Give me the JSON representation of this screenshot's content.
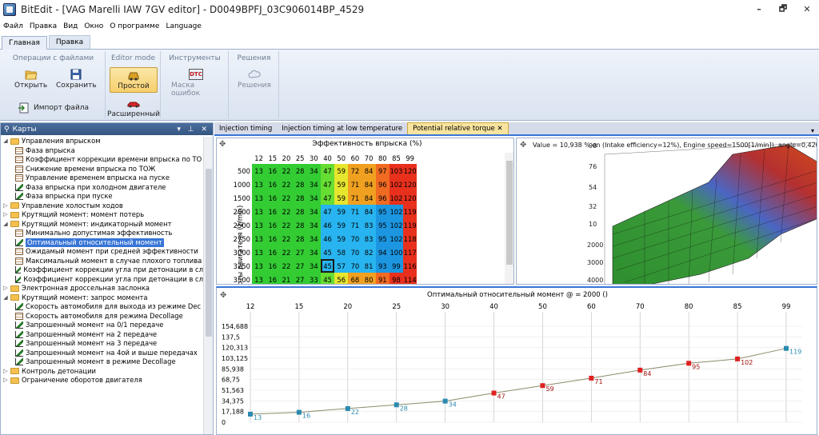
{
  "title": "BitEdit - [VAG Marelli IAW 7GV editor] - D0049BPFJ_03C906014BP_4529",
  "window_buttons": [
    "–",
    "🗗",
    "✕"
  ],
  "menu": [
    "Файл",
    "Правка",
    "Вид",
    "Окно",
    "О программе",
    "Language"
  ],
  "ribbon_tabs": [
    "Главная",
    "Правка"
  ],
  "ribbon": {
    "groups": [
      {
        "title": "Операции с файлами",
        "buttons": [
          "Открыть",
          "Сохранить",
          "Импорт файла"
        ]
      },
      {
        "title": "Editor mode",
        "buttons": [
          "Простой",
          "Расширенный"
        ]
      },
      {
        "title": "Инструменты",
        "buttons": [
          "Маска ошибок"
        ],
        "icon_text": "DTC"
      },
      {
        "title": "Решения",
        "buttons": [
          "Решения"
        ]
      }
    ]
  },
  "left_panel": {
    "title": "Карты",
    "controls": "▾ ⊥ ✕",
    "tree": [
      {
        "level": 0,
        "type": "folder",
        "toggle": "◢",
        "label": "Управления впрыском"
      },
      {
        "level": 1,
        "type": "table",
        "label": "Фаза впрыска"
      },
      {
        "level": 1,
        "type": "table",
        "label": "Коэффициент коррекции времени впрыска по ТО"
      },
      {
        "level": 1,
        "type": "table",
        "label": "Снижение времени впрыска по ТОЖ"
      },
      {
        "level": 1,
        "type": "table",
        "label": "Управление временем впрыска на пуске"
      },
      {
        "level": 1,
        "type": "graph",
        "label": "Фаза впрыска при холодном двигателе"
      },
      {
        "level": 1,
        "type": "graph",
        "label": "Фаза впрыска при пуске"
      },
      {
        "level": 0,
        "type": "folder",
        "toggle": "▷",
        "label": "Управление холостым ходов"
      },
      {
        "level": 0,
        "type": "folder",
        "toggle": "▷",
        "label": "Крутящий момент: момент потерь"
      },
      {
        "level": 0,
        "type": "folder",
        "toggle": "◢",
        "label": "Крутящий момент: индикаторный момент"
      },
      {
        "level": 1,
        "type": "table",
        "label": "Минимально допустимая эффективность"
      },
      {
        "level": 1,
        "type": "graph",
        "label": "Оптимальный относительный момент",
        "selected": true
      },
      {
        "level": 1,
        "type": "table",
        "label": "Ожидамый момент при средней эффективности"
      },
      {
        "level": 1,
        "type": "table",
        "label": "Максимальный момент в случае плохого топлива"
      },
      {
        "level": 1,
        "type": "graph",
        "label": "Коэффициент коррекции угла при детонации в сл"
      },
      {
        "level": 1,
        "type": "graph",
        "label": "Коэффициент коррекции угла при детонации в сл"
      },
      {
        "level": 0,
        "type": "folder",
        "toggle": "▷",
        "label": "Электронная дроссельная заслонка"
      },
      {
        "level": 0,
        "type": "folder",
        "toggle": "◢",
        "label": "Крутящий момент: запрос момента"
      },
      {
        "level": 1,
        "type": "graph",
        "label": "Скорость автомобиля для выхода из режиме Dec"
      },
      {
        "level": 1,
        "type": "table",
        "label": "Скорость автомобиля для режима Decollage"
      },
      {
        "level": 1,
        "type": "graph",
        "label": "Запрошенный момент на 0/1 передаче"
      },
      {
        "level": 1,
        "type": "graph",
        "label": "Запрошенный момент на 2 передаче"
      },
      {
        "level": 1,
        "type": "graph",
        "label": "Запрошенный момент на 3 передаче"
      },
      {
        "level": 1,
        "type": "graph",
        "label": "Запрошенный момент на 4ой и выше передачах"
      },
      {
        "level": 1,
        "type": "graph",
        "label": "Запрошенный момент в режиме Decollage"
      },
      {
        "level": 0,
        "type": "folder",
        "toggle": "▷",
        "label": "Контроль детонации"
      },
      {
        "level": 0,
        "type": "folder",
        "toggle": "▷",
        "label": "Ограничение оборотов двигателя"
      }
    ]
  },
  "doc_tabs": [
    "Injection timing",
    "Injection timing at low temperature",
    "Potential relative torque"
  ],
  "map": {
    "title": "Эффективность впрыска (%)",
    "ylabel": "Обороты двигателя (1/min)",
    "columns": [
      12,
      15,
      20,
      25,
      30,
      40,
      50,
      60,
      70,
      80,
      85,
      99
    ],
    "rows": [
      {
        "rpm": 500,
        "values": [
          13,
          16,
          22,
          28,
          34,
          47,
          59,
          72,
          84,
          97,
          103,
          120
        ]
      },
      {
        "rpm": 1000,
        "values": [
          13,
          16,
          22,
          28,
          34,
          47,
          59,
          71,
          84,
          96,
          102,
          120
        ]
      },
      {
        "rpm": 1500,
        "values": [
          13,
          16,
          22,
          28,
          34,
          47,
          59,
          71,
          84,
          96,
          102,
          120
        ]
      },
      {
        "rpm": 2000,
        "values": [
          13,
          16,
          22,
          28,
          34,
          47,
          59,
          71,
          84,
          95,
          102,
          119
        ]
      },
      {
        "rpm": 2500,
        "values": [
          13,
          16,
          22,
          28,
          34,
          46,
          59,
          71,
          83,
          95,
          102,
          119
        ]
      },
      {
        "rpm": 2750,
        "values": [
          13,
          16,
          22,
          28,
          34,
          46,
          59,
          70,
          83,
          95,
          102,
          118
        ]
      },
      {
        "rpm": 3000,
        "values": [
          13,
          16,
          22,
          27,
          34,
          45,
          58,
          70,
          82,
          94,
          100,
          117
        ]
      },
      {
        "rpm": 3250,
        "values": [
          13,
          16,
          22,
          27,
          34,
          45,
          57,
          70,
          81,
          93,
          99,
          116
        ]
      },
      {
        "rpm": 3500,
        "values": [
          13,
          16,
          21,
          27,
          33,
          45,
          56,
          68,
          80,
          91,
          98,
          114
        ]
      }
    ],
    "colors": {
      "green": "#33cc33",
      "green_light": "#66dd33",
      "yellow": "#e6e62e",
      "orange": "#f0a020",
      "orange_red": "#f06a22",
      "red": "#e8301c",
      "blue": "#28b4f0",
      "blue_dark": "#1c96e0"
    }
  },
  "view3d": {
    "info": "Value = 10,938 % on (Intake efficiency=12%), Engine speed=1500[1/min]), angle=0,4200",
    "left_ticks": [
      "98",
      "76",
      "54",
      "32",
      "10"
    ],
    "bottom_ticks": [
      "2000",
      "3000",
      "4000"
    ]
  },
  "chart_data": {
    "type": "line",
    "title": "Оптимальный относительный момент @  = 2000 ()",
    "x": [
      12,
      15,
      20,
      25,
      30,
      40,
      50,
      60,
      70,
      80,
      85,
      99
    ],
    "y": [
      13,
      16,
      22,
      28,
      34,
      47,
      59,
      71,
      84,
      95,
      102,
      119
    ],
    "point_labels": [
      "13",
      "16",
      "22",
      "28",
      "34",
      "47",
      "59",
      "71",
      "84",
      "95",
      "102",
      "119"
    ],
    "yticks": [
      "154,688",
      "137,5",
      "120,313",
      "103,125",
      "85,938",
      "68,75",
      "51,563",
      "34,375",
      "17,188",
      "0"
    ],
    "ylim": [
      0,
      154.688
    ],
    "grid": true
  }
}
